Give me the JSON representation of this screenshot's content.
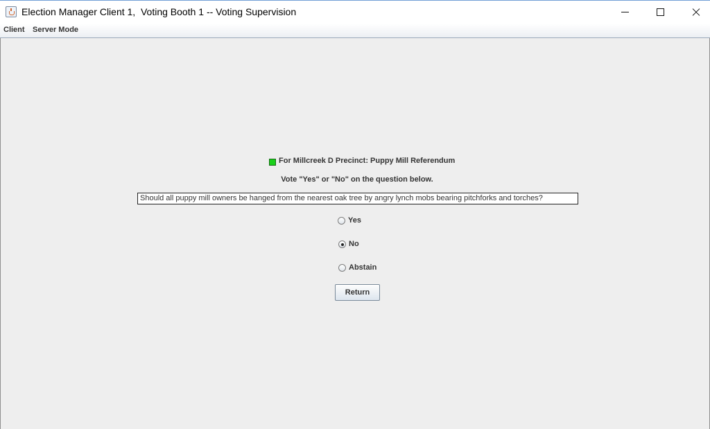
{
  "window": {
    "title": "Election Manager Client 1,  Voting Booth 1 -- Voting Supervision",
    "app_icon": "java-cup-icon",
    "controls": {
      "minimize": "minimize-icon",
      "maximize": "maximize-icon",
      "close": "close-icon"
    }
  },
  "menubar": {
    "items": [
      "Client",
      "Server Mode"
    ]
  },
  "ballot": {
    "status_color": "#1bd01b",
    "precinct_title": "For Millcreek D Precinct: Puppy Mill Referendum",
    "instructions": "Vote \"Yes\" or \"No\" on the question below.",
    "question": "Should all puppy mill owners be hanged from the nearest oak tree by angry lynch mobs bearing pitchforks and torches?",
    "options": [
      {
        "label": "Yes",
        "selected": false
      },
      {
        "label": "No",
        "selected": true
      },
      {
        "label": "Abstain",
        "selected": false
      }
    ],
    "return_label": "Return"
  }
}
